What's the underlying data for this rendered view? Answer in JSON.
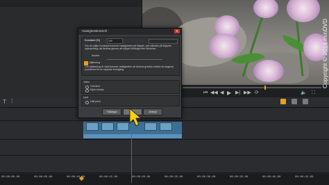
{
  "watermark": "Copyright © 2014 minDVD",
  "dialog": {
    "title": "Hastighetskontroll",
    "close_label": "x",
    "constant_label": "Konstant (%)",
    "constant_value": "100",
    "constant_desc": "Om du väljer Konstant kommer hastigheten på klippet, och således på klippets uppspelning, att ändras genom att klippet förlängs eller förkortas.",
    "anchor_label": "Ankare",
    "smooth_label": "Utjämning",
    "smooth_desc": "Om Utjämning är vald kommer hastigheten att ändras gradvis mellan de angivna punkterna för en mjukare övergång.",
    "video_section_label": "Video",
    "video_option_reverse": "Omvänd",
    "video_option_smooth": "Mjuk rörelse",
    "audio_section_label": "Ljud",
    "audio_option_pitch": "Håll pitch",
    "buttons": {
      "cancel": "Tillämpa",
      "ok": "OK",
      "apply": "Avbryt"
    },
    "smooth_checked": true
  },
  "player": {
    "skip_back": "⏮",
    "rewind": "◀◀",
    "step_back": "◀",
    "play": "▶",
    "step_fwd": "▶|",
    "ffwd": "▶▶",
    "loop": "⟳",
    "volume": "🔈",
    "fullscreen": "⛶"
  },
  "timeline": {
    "timecodes": [
      "00:00:00.00",
      "00:00:05.00",
      "00:00:10.00",
      "00:00:15.00",
      "00:00:20.00",
      "00:00:25.00",
      "00:00:30.00",
      "00:00:35.00",
      "00:00:40.00",
      "00:00:45.00"
    ]
  },
  "colors": {
    "accent": "#e8a020",
    "playhead": "#d23a2a",
    "clip": "#3d6f96"
  }
}
